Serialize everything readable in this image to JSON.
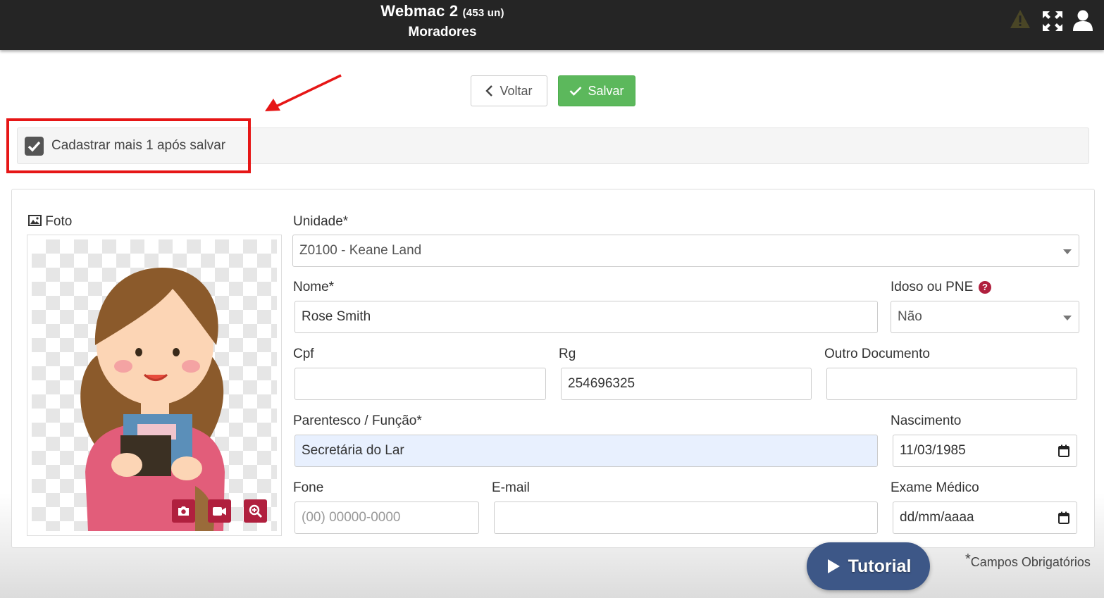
{
  "header": {
    "app_name": "Webmac 2",
    "unit_count": "(453 un)",
    "page_title": "Moradores",
    "icons": [
      "warning-icon",
      "fullscreen-icon",
      "user-icon"
    ]
  },
  "toolbar": {
    "back_label": "Voltar",
    "save_label": "Salvar"
  },
  "options": {
    "register_another_label": "Cadastrar mais 1 após salvar",
    "register_another_checked": true
  },
  "photo": {
    "label": "Foto",
    "actions": [
      "camera-icon",
      "video-icon",
      "zoom-in-icon"
    ]
  },
  "form": {
    "unidade": {
      "label": "Unidade*",
      "value": "Z0100 - Keane Land"
    },
    "nome": {
      "label": "Nome*",
      "value": "Rose Smith"
    },
    "idoso": {
      "label": "Idoso ou PNE",
      "help": "?",
      "value": "Não"
    },
    "cpf": {
      "label": "Cpf",
      "value": ""
    },
    "rg": {
      "label": "Rg",
      "value": "254696325"
    },
    "outro_documento": {
      "label": "Outro Documento",
      "value": ""
    },
    "parentesco": {
      "label": "Parentesco / Função*",
      "value": "Secretária do Lar"
    },
    "nascimento": {
      "label": "Nascimento",
      "value": "11/03/1985"
    },
    "fone": {
      "label": "Fone",
      "placeholder": "(00) 00000-0000"
    },
    "email": {
      "label": "E-mail",
      "value": ""
    },
    "exame_medico": {
      "label": "Exame Médico",
      "placeholder": "dd/mm/aaaa"
    }
  },
  "footer": {
    "tutorial_label": "Tutorial",
    "required_star": "*",
    "required_note": "Campos Obrigatórios"
  },
  "colors": {
    "header_bg": "#252525",
    "save_green": "#5cb85c",
    "accent_red": "#b0203e",
    "annotation_red": "#e61616",
    "tutorial_blue": "#3d5787",
    "autofill_blue": "#e8f0fe"
  }
}
